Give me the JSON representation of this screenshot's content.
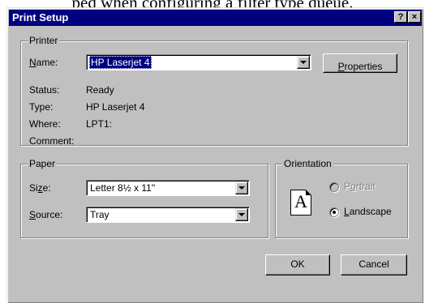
{
  "background_text": "ped when configuring a filter type queue.",
  "window": {
    "title": "Print Setup",
    "help_button": "?",
    "close_button": "×"
  },
  "printer": {
    "legend": "Printer",
    "name_label_hotkey": "N",
    "name_label_rest": "ame:",
    "name_value": "HP Laserjet 4",
    "properties_hotkey": "P",
    "properties_rest": "roperties",
    "status_label": "Status:",
    "status_value": "Ready",
    "type_label": "Type:",
    "type_value": "HP Laserjet 4",
    "where_label": "Where:",
    "where_value": "LPT1:",
    "comment_label": "Comment:"
  },
  "paper": {
    "legend": "Paper",
    "size_label_pre": "Si",
    "size_label_hotkey": "z",
    "size_label_post": "e:",
    "size_value": "Letter 8½ x 11\"",
    "source_label_hotkey": "S",
    "source_label_rest": "ource:",
    "source_value": "Tray"
  },
  "orientation": {
    "legend": "Orientation",
    "page_icon_letter": "A",
    "portrait_pre": "P",
    "portrait_hotkey": "o",
    "portrait_post": "rtrait",
    "portrait_checked": false,
    "landscape_hotkey": "L",
    "landscape_rest": "andscape",
    "landscape_checked": true
  },
  "buttons": {
    "ok": "OK",
    "cancel": "Cancel"
  }
}
